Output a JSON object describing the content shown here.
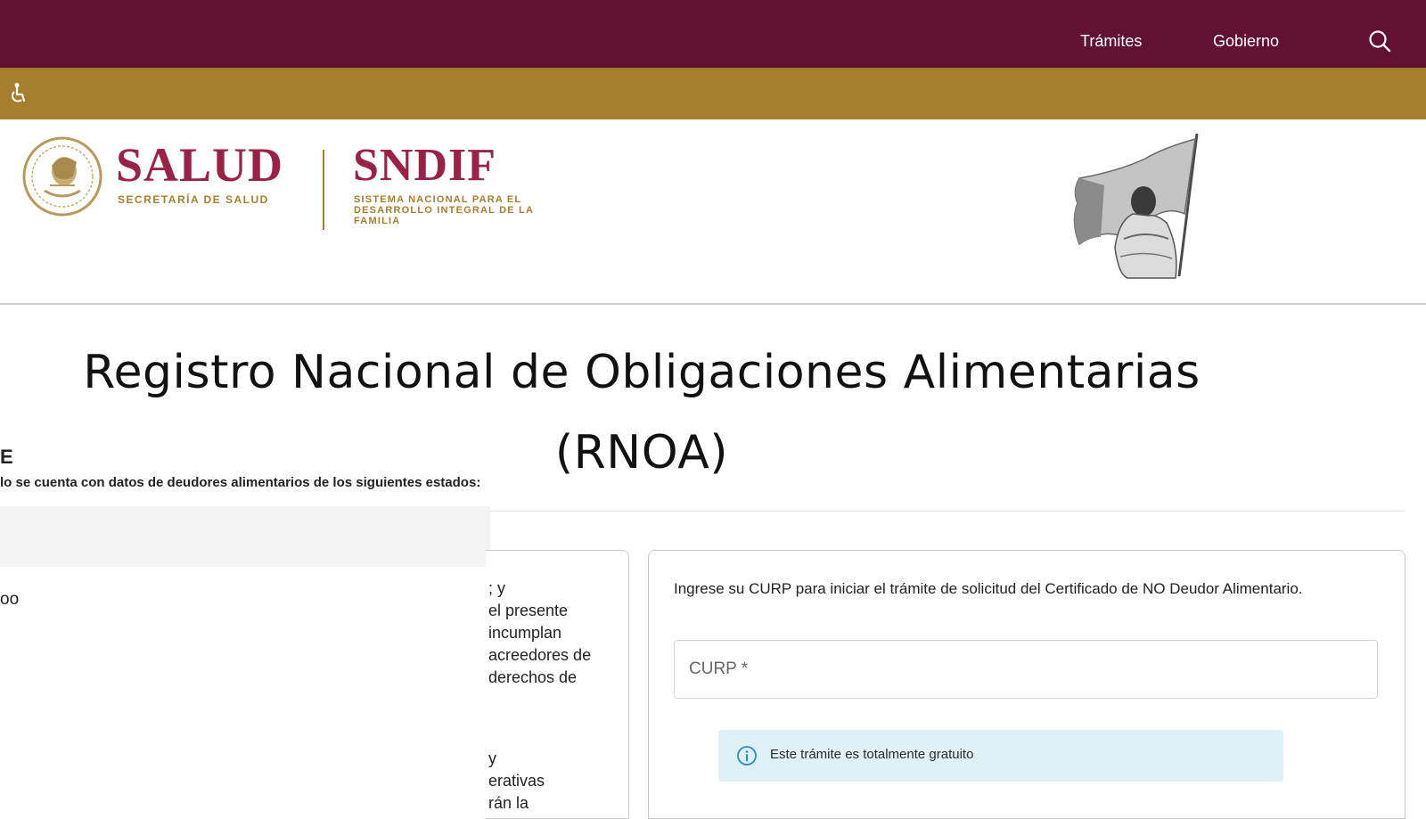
{
  "topbar": {
    "nav": [
      {
        "label": "Trámites"
      },
      {
        "label": "Gobierno"
      }
    ],
    "color": "#611232"
  },
  "goldbar": {
    "color": "#a57f2c"
  },
  "brand": {
    "salud_title": "SALUD",
    "salud_subtitle": "SECRETARÍA DE SALUD",
    "sndif_title": "SNDIF",
    "sndif_subtitle": "SISTEMA NACIONAL PARA EL DESARROLLO INTEGRAL DE LA FAMILIA",
    "primary_color": "#9b2247",
    "accent_color": "#a57f2c"
  },
  "main": {
    "title_line1": "Registro Nacional de Obligaciones Alimentarias",
    "title_line2": "(RNOA)"
  },
  "left_overlay": {
    "heading_fragment": "E",
    "notice_fragment": "lo se cuenta con datos de deudores alimentarios de los siguientes estados:",
    "text_fragment1": "oo",
    "text_fragment2": ""
  },
  "middle_card": {
    "lines": [
      "; y",
      "el presente",
      "incumplan",
      "acreedores de",
      "derechos de"
    ],
    "lines2": [
      "y",
      "erativas",
      "rán la"
    ]
  },
  "form": {
    "instructions": "Ingrese su CURP para iniciar el trámite de solicitud del Certificado de NO Deudor Alimentario.",
    "curp_placeholder": "CURP *",
    "info_text": "Este trámite es totalmente gratuito"
  },
  "icons": {
    "search": "search-icon",
    "accessibility": "accessibility-icon",
    "info": "info-icon",
    "seal": "mexican-coat-of-arms-seal"
  }
}
